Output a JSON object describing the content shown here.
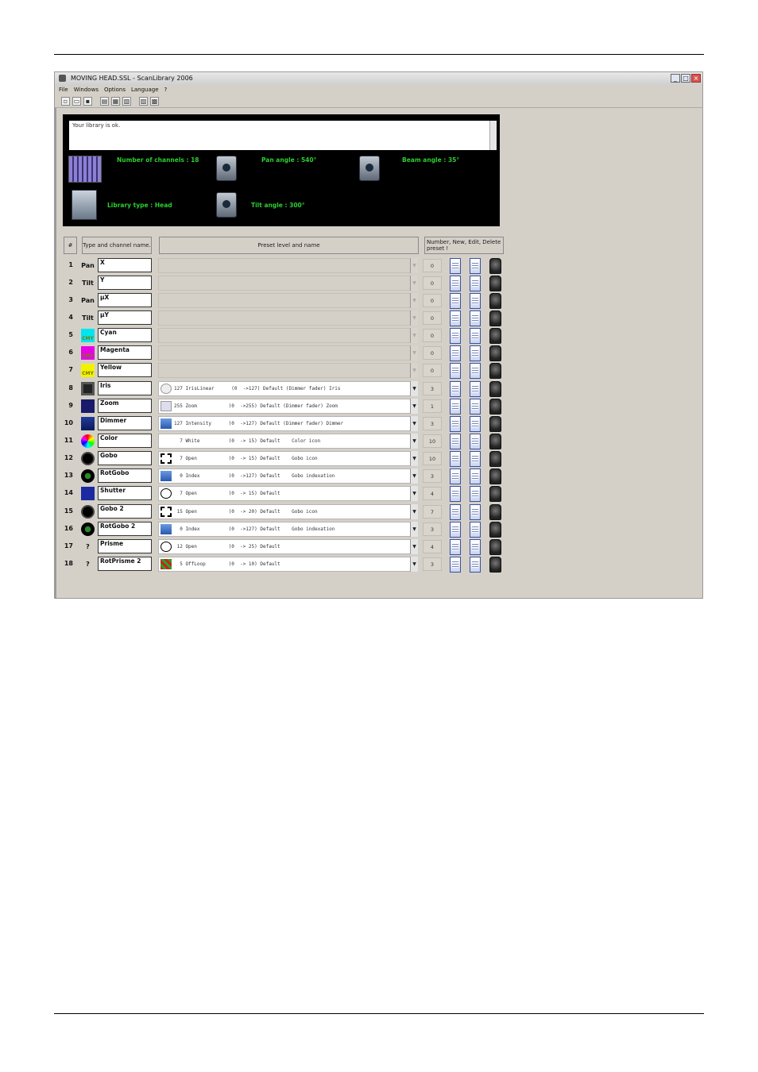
{
  "window": {
    "title": "MOVING HEAD.SSL - ScanLibrary 2006",
    "controls": [
      "minimize-icon",
      "maximize-icon",
      "close-icon"
    ]
  },
  "menu": [
    "File",
    "Windows",
    "Options",
    "Language",
    "?"
  ],
  "toolbar": [
    "new-file-icon",
    "open-folder-icon",
    "save-icon",
    "print-icon",
    "print-preview-icon",
    "export-icon",
    "import-icon",
    "info-icon"
  ],
  "info": {
    "message": "Your library is ok.",
    "channels_label": "Number of channels : 18",
    "pan_label": "Pan angle : 540°",
    "beam_label": "Beam angle : 35°",
    "library_label": "Library type : Head",
    "tilt_label": "Tilt angle : 300°"
  },
  "headers": {
    "num": "#",
    "type": "Type and channel name.",
    "preset": "Preset level and name",
    "actions": "Number, New, Edit, Delete preset !"
  },
  "rows": [
    {
      "n": "1",
      "type_label": "Pan",
      "name": "X",
      "preset": "",
      "count": "0"
    },
    {
      "n": "2",
      "type_label": "Tilt",
      "name": "Y",
      "preset": "",
      "count": "0"
    },
    {
      "n": "3",
      "type_label": "Pan",
      "name": "µX",
      "preset": "",
      "count": "0"
    },
    {
      "n": "4",
      "type_label": "Tilt",
      "name": "µY",
      "preset": "",
      "count": "0"
    },
    {
      "n": "5",
      "type_label": "CMY",
      "name": "Cyan",
      "preset": "",
      "count": "0"
    },
    {
      "n": "6",
      "type_label": "CMY",
      "name": "Magenta",
      "preset": "",
      "count": "0"
    },
    {
      "n": "7",
      "type_label": "CMY",
      "name": "Yellow",
      "preset": "",
      "count": "0"
    },
    {
      "n": "8",
      "type_label": "",
      "name": "Iris",
      "preset": "127 IrisLinear      (0  ->127) Default (Dimmer fader) Iris",
      "count": "3"
    },
    {
      "n": "9",
      "type_label": "",
      "name": "Zoom",
      "preset": "255 Zoom           (0  ->255) Default (Dimmer fader) Zoom",
      "count": "1"
    },
    {
      "n": "10",
      "type_label": "",
      "name": "Dimmer",
      "preset": "127 Intensity      (0  ->127) Default (Dimmer fader) Dimmer",
      "count": "3"
    },
    {
      "n": "11",
      "type_label": "",
      "name": "Color",
      "preset": "  7 White          (0  -> 15) Default    Color icon",
      "count": "10"
    },
    {
      "n": "12",
      "type_label": "",
      "name": "Gobo",
      "preset": "  7 Open           (0  -> 15) Default    Gobo icon",
      "count": "10"
    },
    {
      "n": "13",
      "type_label": "",
      "name": "RotGobo",
      "preset": "  0 Index          (0  ->127) Default    Gobo indexation",
      "count": "3"
    },
    {
      "n": "14",
      "type_label": "",
      "name": "Shutter",
      "preset": "  7 Open           (0  -> 15) Default",
      "count": "4"
    },
    {
      "n": "15",
      "type_label": "",
      "name": "Gobo 2",
      "preset": " 15 Open           (0  -> 20) Default    Gobo icon",
      "count": "7"
    },
    {
      "n": "16",
      "type_label": "",
      "name": "RotGobo 2",
      "preset": "  0 Index          (0  ->127) Default    Gobo indexation",
      "count": "3"
    },
    {
      "n": "17",
      "type_label": "?",
      "name": "Prisme",
      "preset": " 12 Open           (0  -> 25) Default",
      "count": "4"
    },
    {
      "n": "18",
      "type_label": "?",
      "name": "RotPrisme 2",
      "preset": "  5 OffLoop        (0  -> 10) Default",
      "count": "3"
    }
  ],
  "colors": {
    "cyan": "#00e5f0",
    "magenta": "#e600e6",
    "yellow": "#f2f200",
    "info_text": "#2ecc30"
  }
}
